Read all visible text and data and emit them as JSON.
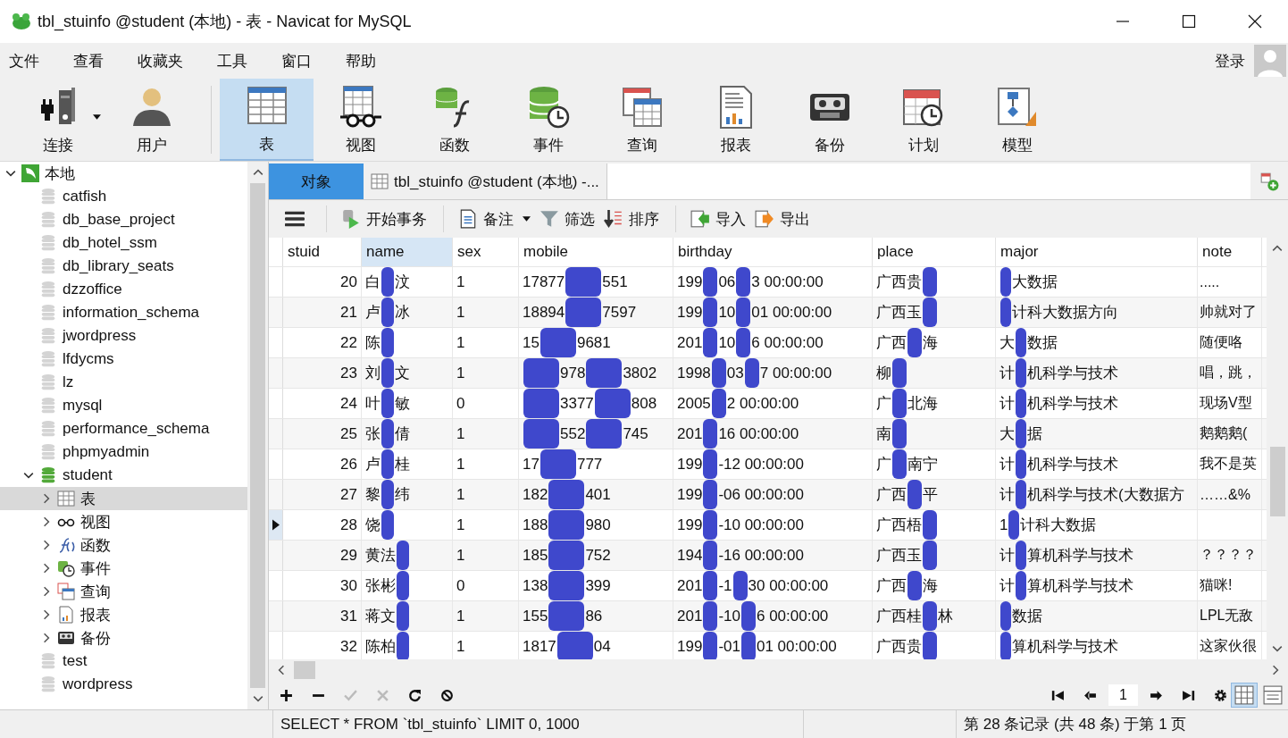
{
  "window": {
    "title": "tbl_stuinfo @student (本地) - 表 - Navicat for MySQL"
  },
  "menu": [
    "文件",
    "查看",
    "收藏夹",
    "工具",
    "窗口",
    "帮助"
  ],
  "login": "登录",
  "toolbar": [
    {
      "label": "连接",
      "kind": "connection",
      "selected": false,
      "dropdown": true
    },
    {
      "label": "用户",
      "kind": "user",
      "selected": false,
      "dropdown": false
    },
    {
      "label": "表",
      "kind": "table",
      "selected": true,
      "dropdown": false
    },
    {
      "label": "视图",
      "kind": "view",
      "selected": false,
      "dropdown": false
    },
    {
      "label": "函数",
      "kind": "function",
      "selected": false,
      "dropdown": false
    },
    {
      "label": "事件",
      "kind": "event",
      "selected": false,
      "dropdown": false
    },
    {
      "label": "查询",
      "kind": "query",
      "selected": false,
      "dropdown": false
    },
    {
      "label": "报表",
      "kind": "report",
      "selected": false,
      "dropdown": false
    },
    {
      "label": "备份",
      "kind": "backup",
      "selected": false,
      "dropdown": false
    },
    {
      "label": "计划",
      "kind": "schedule",
      "selected": false,
      "dropdown": false
    },
    {
      "label": "模型",
      "kind": "model",
      "selected": false,
      "dropdown": false
    }
  ],
  "sidebar": {
    "tree": [
      {
        "label": "本地",
        "kind": "connection",
        "expanded": true,
        "selected": false,
        "children": [
          {
            "label": "catfish",
            "kind": "db",
            "open": false,
            "selected": false
          },
          {
            "label": "db_base_project",
            "kind": "db",
            "open": false,
            "selected": false
          },
          {
            "label": "db_hotel_ssm",
            "kind": "db",
            "open": false,
            "selected": false
          },
          {
            "label": "db_library_seats",
            "kind": "db",
            "open": false,
            "selected": false
          },
          {
            "label": "dzzoffice",
            "kind": "db",
            "open": false,
            "selected": false
          },
          {
            "label": "information_schema",
            "kind": "db",
            "open": false,
            "selected": false
          },
          {
            "label": "jwordpress",
            "kind": "db",
            "open": false,
            "selected": false
          },
          {
            "label": "lfdycms",
            "kind": "db",
            "open": false,
            "selected": false
          },
          {
            "label": "lz",
            "kind": "db",
            "open": false,
            "selected": false
          },
          {
            "label": "mysql",
            "kind": "db",
            "open": false,
            "selected": false
          },
          {
            "label": "performance_schema",
            "kind": "db",
            "open": false,
            "selected": false
          },
          {
            "label": "phpmyadmin",
            "kind": "db",
            "open": false,
            "selected": false
          },
          {
            "label": "student",
            "kind": "db",
            "open": true,
            "expanded": true,
            "selected": false,
            "children": [
              {
                "label": "表",
                "kind": "table",
                "expanded": false,
                "selected": true
              },
              {
                "label": "视图",
                "kind": "view",
                "expanded": false,
                "selected": false
              },
              {
                "label": "函数",
                "kind": "function",
                "expanded": false,
                "selected": false
              },
              {
                "label": "事件",
                "kind": "event",
                "expanded": false,
                "selected": false
              },
              {
                "label": "查询",
                "kind": "query",
                "expanded": false,
                "selected": false
              },
              {
                "label": "报表",
                "kind": "report",
                "expanded": false,
                "selected": false
              },
              {
                "label": "备份",
                "kind": "backup",
                "expanded": false,
                "selected": false
              }
            ]
          },
          {
            "label": "test",
            "kind": "db",
            "open": false,
            "selected": false
          },
          {
            "label": "wordpress",
            "kind": "db",
            "open": false,
            "selected": false
          }
        ]
      }
    ]
  },
  "tabs": [
    {
      "label": "对象",
      "selected": true,
      "kind": "plain"
    },
    {
      "label": "tbl_stuinfo @student (本地) -...",
      "selected": false,
      "kind": "table"
    }
  ],
  "grid_toolbar": [
    {
      "label": "开始事务",
      "kind": "transaction",
      "dropdown": false
    },
    {
      "label": "备注",
      "kind": "memo",
      "dropdown": true
    },
    {
      "label": "筛选",
      "kind": "filter",
      "dropdown": false
    },
    {
      "label": "排序",
      "kind": "sort",
      "dropdown": false
    },
    {
      "label": "导入",
      "kind": "import",
      "dropdown": false
    },
    {
      "label": "导出",
      "kind": "export",
      "dropdown": false
    }
  ],
  "table": {
    "columns": [
      {
        "label": "stuid",
        "selected": false
      },
      {
        "label": "name",
        "selected": true
      },
      {
        "label": "sex",
        "selected": false
      },
      {
        "label": "mobile",
        "selected": false
      },
      {
        "label": "birthday",
        "selected": false
      },
      {
        "label": "place",
        "selected": false
      },
      {
        "label": "major",
        "selected": false
      },
      {
        "label": "note",
        "selected": false
      }
    ],
    "rows": [
      {
        "selected": false,
        "cells": [
          [
            "20"
          ],
          [
            "白",
            null,
            "汶"
          ],
          [
            "1"
          ],
          [
            "17877",
            null,
            "551"
          ],
          [
            "199",
            null,
            "06",
            null,
            "3 00:00:00"
          ],
          [
            "广西贵",
            null
          ],
          [
            null,
            "大数据"
          ],
          [
            "....."
          ]
        ]
      },
      {
        "selected": false,
        "cells": [
          [
            "21"
          ],
          [
            "卢",
            null,
            "冰"
          ],
          [
            "1"
          ],
          [
            "18894",
            null,
            "7597"
          ],
          [
            "199",
            null,
            "10",
            null,
            "01 00:00:00"
          ],
          [
            "广西玉",
            null
          ],
          [
            null,
            "计科大数据方向"
          ],
          [
            "帅就对了"
          ]
        ]
      },
      {
        "selected": false,
        "cells": [
          [
            "22"
          ],
          [
            "陈",
            null
          ],
          [
            "1"
          ],
          [
            "15",
            null,
            "9681"
          ],
          [
            "201",
            null,
            "10",
            null,
            "6 00:00:00"
          ],
          [
            "广西",
            null,
            "海"
          ],
          [
            "大",
            null,
            "数据"
          ],
          [
            "随便咯"
          ]
        ]
      },
      {
        "selected": false,
        "cells": [
          [
            "23"
          ],
          [
            "刘",
            null,
            "文"
          ],
          [
            "1"
          ],
          [
            null,
            "978",
            null,
            "3802"
          ],
          [
            "1998",
            null,
            "03",
            null,
            "7 00:00:00"
          ],
          [
            "柳",
            null
          ],
          [
            "计",
            null,
            "机科学与技术"
          ],
          [
            "唱，跳，"
          ]
        ]
      },
      {
        "selected": false,
        "cells": [
          [
            "24"
          ],
          [
            "叶",
            null,
            "敏"
          ],
          [
            "0"
          ],
          [
            null,
            "3377",
            null,
            "808"
          ],
          [
            "2005",
            null,
            "2 00:00:00"
          ],
          [
            "广",
            null,
            "北海"
          ],
          [
            "计",
            null,
            "机科学与技术"
          ],
          [
            "现场V型"
          ]
        ]
      },
      {
        "selected": false,
        "cells": [
          [
            "25"
          ],
          [
            "张",
            null,
            "倩"
          ],
          [
            "1"
          ],
          [
            null,
            "552",
            null,
            "745"
          ],
          [
            "201",
            null,
            "16 00:00:00"
          ],
          [
            "南",
            null
          ],
          [
            "大",
            null,
            "据"
          ],
          [
            "鹅鹅鹅("
          ]
        ]
      },
      {
        "selected": false,
        "cells": [
          [
            "26"
          ],
          [
            "卢",
            null,
            "桂"
          ],
          [
            "1"
          ],
          [
            "17",
            null,
            "777"
          ],
          [
            "199",
            null,
            "-12 00:00:00"
          ],
          [
            "广",
            null,
            "南宁"
          ],
          [
            "计",
            null,
            "机科学与技术"
          ],
          [
            "我不是英"
          ]
        ]
      },
      {
        "selected": false,
        "cells": [
          [
            "27"
          ],
          [
            "黎",
            null,
            "纬"
          ],
          [
            "1"
          ],
          [
            "182",
            null,
            "401"
          ],
          [
            "199",
            null,
            "-06 00:00:00"
          ],
          [
            "广西",
            null,
            "平"
          ],
          [
            "计",
            null,
            "机科学与技术(大数据方"
          ],
          [
            "……&%"
          ]
        ]
      },
      {
        "selected": true,
        "cells": [
          [
            "28"
          ],
          [
            "饶",
            null
          ],
          [
            "1"
          ],
          [
            "188",
            null,
            "980"
          ],
          [
            "199",
            null,
            "-10 00:00:00"
          ],
          [
            "广西梧",
            null
          ],
          [
            "1",
            null,
            "计科大数据"
          ],
          []
        ]
      },
      {
        "selected": false,
        "cells": [
          [
            "29"
          ],
          [
            "黄法",
            null
          ],
          [
            "1"
          ],
          [
            "185",
            null,
            "752"
          ],
          [
            "194",
            null,
            "-16 00:00:00"
          ],
          [
            "广西玉",
            null
          ],
          [
            "计",
            null,
            "算机科学与技术"
          ],
          [
            "？？？？"
          ]
        ]
      },
      {
        "selected": false,
        "cells": [
          [
            "30"
          ],
          [
            "张彬",
            null
          ],
          [
            "0"
          ],
          [
            "138",
            null,
            "399"
          ],
          [
            "201",
            null,
            "-1",
            null,
            "30 00:00:00"
          ],
          [
            "广西",
            null,
            "海"
          ],
          [
            "计",
            null,
            "算机科学与技术"
          ],
          [
            "猫咪!"
          ]
        ]
      },
      {
        "selected": false,
        "cells": [
          [
            "31"
          ],
          [
            "蒋文",
            null
          ],
          [
            "1"
          ],
          [
            "155",
            null,
            "86"
          ],
          [
            "201",
            null,
            "-10",
            null,
            "6 00:00:00"
          ],
          [
            "广西桂",
            null,
            "林"
          ],
          [
            null,
            "数据"
          ],
          [
            "LPL无敌"
          ]
        ]
      },
      {
        "selected": false,
        "cells": [
          [
            "32"
          ],
          [
            "陈柏",
            null
          ],
          [
            "1"
          ],
          [
            "1817",
            null,
            "04"
          ],
          [
            "199",
            null,
            "-01",
            null,
            "01 00:00:00"
          ],
          [
            "广西贵",
            null
          ],
          [
            null,
            "算机科学与技术"
          ],
          [
            "这家伙很"
          ]
        ]
      }
    ]
  },
  "bottom_toolbar": [
    {
      "kind": "add",
      "disabled": false
    },
    {
      "kind": "delete",
      "disabled": false
    },
    {
      "kind": "apply",
      "disabled": true
    },
    {
      "kind": "cancel",
      "disabled": true
    },
    {
      "kind": "refresh",
      "disabled": false
    },
    {
      "kind": "stop",
      "disabled": false
    }
  ],
  "pager": {
    "page": "1"
  },
  "view_modes": [
    {
      "kind": "grid",
      "selected": true
    },
    {
      "kind": "form",
      "selected": false
    }
  ],
  "status_bar": {
    "sql": "SELECT * FROM `tbl_stuinfo` LIMIT 0, 1000",
    "record": "第 28 条记录 (共 48 条) 于第 1 页"
  }
}
